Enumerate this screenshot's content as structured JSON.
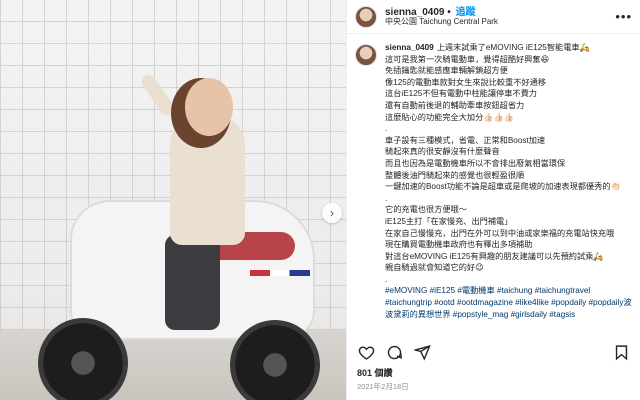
{
  "post": {
    "username": "sienna_0409",
    "separator": "•",
    "follow_label": "追蹤",
    "location": "中央公園 Taichung Central Park",
    "more_icon": "more-horizontal-icon",
    "caption_body": "上週末試乘了eMOVING iE125智能電車🛵\n這可是我第一次騎電動車，覺得超酷好興奮😆\n免插鑰匙就能感應車輛解鎖超方便\n像125的電動車款對女生來說比較重不好通移\n這台iE125不但有電動中柱能讓停車不費力\n還有自動前後退的輔助牽車按鈕超省力\n這麼貼心的功能完全大加分👍🏻👍🏻👍🏻\n.\n車子設有三種模式，省電、正常和Boost加速\n騎起來真的很安靜沒有什麼聲音\n而且也因為是電動機車所以不會排出廢氣相當環保\n整體後油門騎起來的感覺也很輕盈很順\n一鍵加速的Boost功能不論是超車或是爬坡的加速表現都優秀的👏🏻\n.\n它的充電也很方便哦～\niE125主打「在家慢充、出門補電」\n在家自己慢慢充，出門在外可以到中油或家樂福的充電站快充哦\n現在購買電動機車政府也有釋出多項補助\n對這台eMOVING iE125有興趣的朋友建議可以先預約試乘🛵\n親自騎過就會知道它的好😉\n.",
    "hashtags": "#eMOVING #iE125 #電動機車 #taichung #taichungtravel #taichungtrip #ootd #ootdmagazine #like4like #popdaily #popdaily波波黛莉的異想世界 #popstyle_mag #girlsdaily #tagsis",
    "likes": "801 個讚",
    "date": "2021年2月18日"
  },
  "icons": {
    "like": "heart-icon",
    "comment": "comment-icon",
    "share": "share-icon",
    "save": "bookmark-icon",
    "next": "chevron-right-icon"
  },
  "colors": {
    "link": "#0095f6",
    "hashtag": "#00376b"
  }
}
